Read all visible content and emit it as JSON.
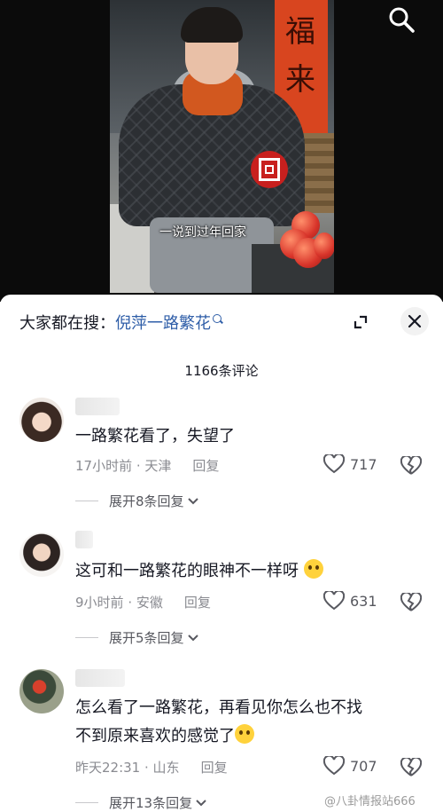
{
  "video": {
    "subtitle": "一说到过年回家",
    "banner_chars": [
      "福",
      "来"
    ]
  },
  "search_icon": "search-icon",
  "sheet": {
    "search_prefix": "大家都在搜：",
    "search_keyword": "倪萍一路繁花",
    "comment_count": "1166条评论"
  },
  "comments": [
    {
      "text": "一路繁花看了，失望了",
      "time": "17小时前",
      "location": "天津",
      "reply": "回复",
      "likes": "717",
      "expand": "展开8条回复"
    },
    {
      "text": "这可和一路繁花的眼神不一样呀",
      "time": "9小时前",
      "location": "安徽",
      "reply": "回复",
      "likes": "631",
      "expand": "展开5条回复"
    },
    {
      "text_line1": "怎么看了一路繁花，再看见你怎么也不找",
      "text_line2": "不到原来喜欢的感觉了",
      "time": "昨天22:31",
      "location": "山东",
      "reply": "回复",
      "likes": "707",
      "expand": "展开13条回复"
    }
  ],
  "watermark": "@八卦情报站666",
  "colors": {
    "keyword": "#2f5ea8",
    "badge": "#c8201e",
    "muted": "#8a8b91"
  }
}
